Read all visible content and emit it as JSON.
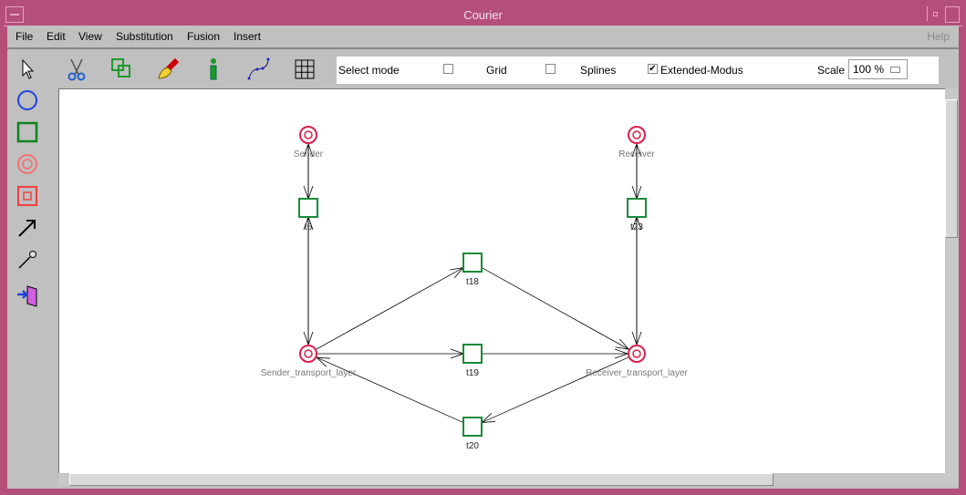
{
  "window": {
    "title": "Courier"
  },
  "menu": {
    "items": [
      "File",
      "Edit",
      "View",
      "Substitution",
      "Fusion",
      "Insert"
    ],
    "help": "Help"
  },
  "toolbar": {
    "icons": [
      "scissors-icon",
      "copy-icon",
      "paint-brush-icon",
      "info-icon",
      "spline-icon",
      "grid-icon"
    ]
  },
  "palette": {
    "icons": [
      "pointer-icon",
      "place-icon",
      "transition-icon",
      "fusion-place-icon",
      "substitution-transition-icon",
      "arc-icon",
      "inhibitor-arc-icon",
      "exit-icon"
    ]
  },
  "options": {
    "select_mode": "Select mode",
    "select_mode_checked": false,
    "grid": "Grid",
    "grid_checked": false,
    "splines": "Splines",
    "extended": "Extended-Modus",
    "extended_checked": true,
    "scale_label": "Scale",
    "scale_value": "100 %"
  },
  "net": {
    "places": [
      {
        "id": "Sender",
        "label": "Sender"
      },
      {
        "id": "Receiver",
        "label": "Receiver"
      },
      {
        "id": "STL",
        "label": "Sender_transport_layer"
      },
      {
        "id": "RTL",
        "label": "Receiver_transport_layer"
      }
    ],
    "transitions": [
      {
        "id": "t6",
        "label": "t6"
      },
      {
        "id": "t23",
        "label": "t23"
      },
      {
        "id": "t18",
        "label": "t18"
      },
      {
        "id": "t19",
        "label": "t19"
      },
      {
        "id": "t20",
        "label": "t20"
      }
    ],
    "arcs": [
      [
        "Sender",
        "t6"
      ],
      [
        "t6",
        "Sender"
      ],
      [
        "t6",
        "STL"
      ],
      [
        "STL",
        "t6"
      ],
      [
        "Receiver",
        "t23"
      ],
      [
        "t23",
        "Receiver"
      ],
      [
        "t23",
        "RTL"
      ],
      [
        "RTL",
        "t23"
      ],
      [
        "STL",
        "t18"
      ],
      [
        "t18",
        "RTL"
      ],
      [
        "STL",
        "t19"
      ],
      [
        "t19",
        "RTL"
      ],
      [
        "RTL",
        "t20"
      ],
      [
        "t20",
        "STL"
      ]
    ],
    "place_color": "#d8204a",
    "transition_color": "#1a8a3a"
  }
}
